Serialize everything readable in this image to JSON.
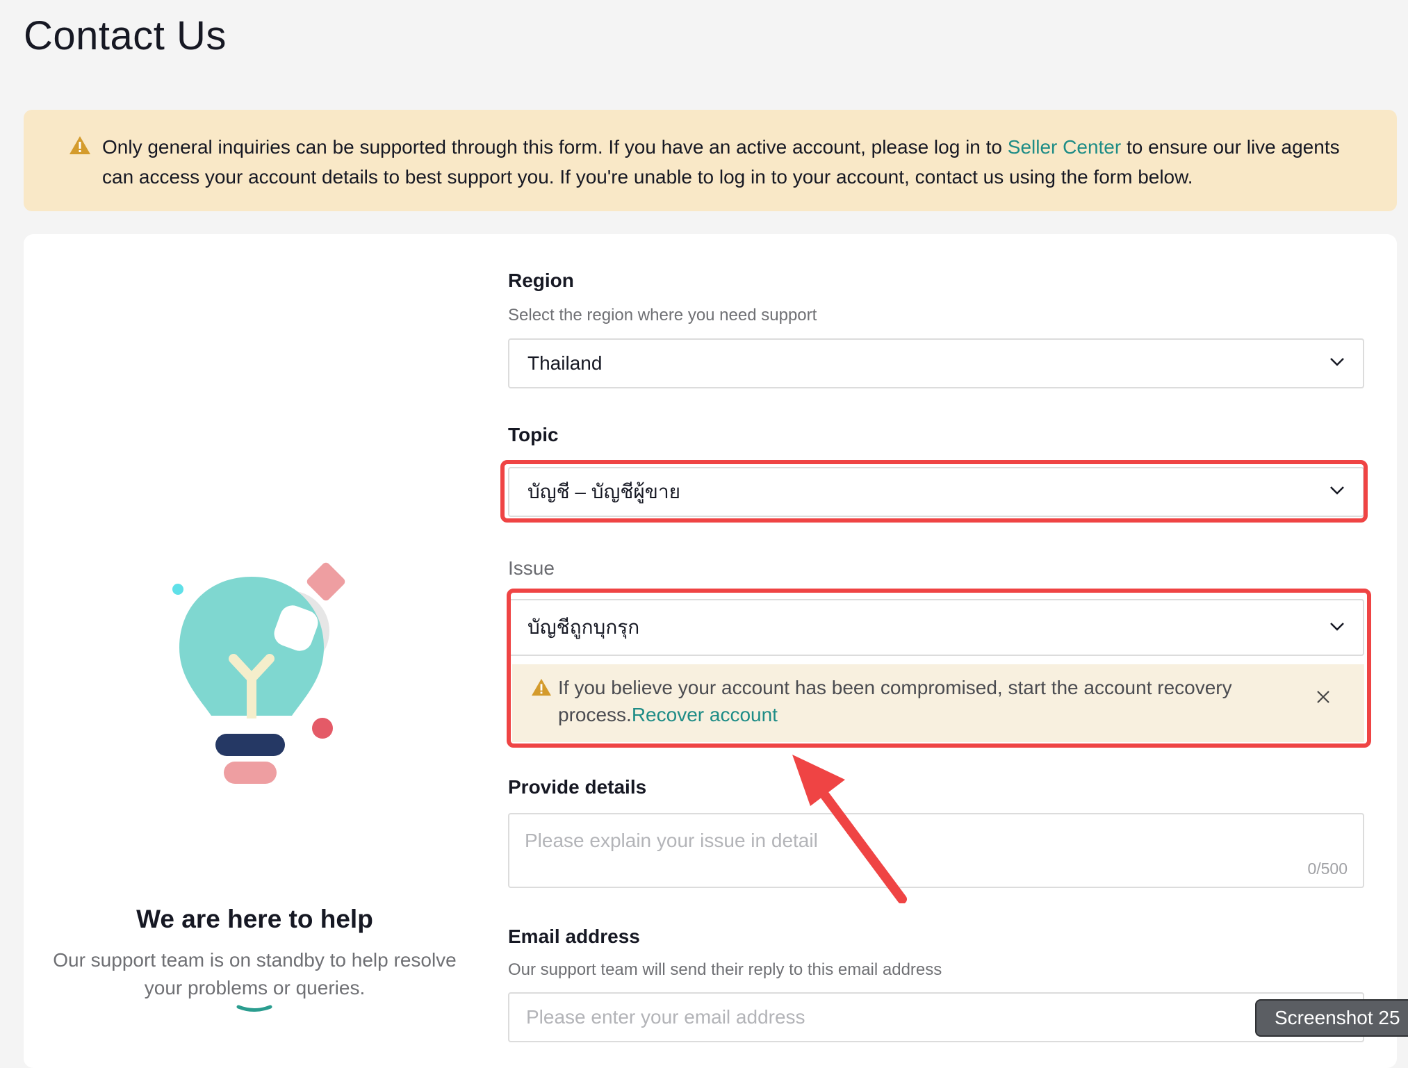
{
  "page": {
    "title": "Contact Us"
  },
  "notice": {
    "text_before": "Only general inquiries can be supported through this form. If you have an active account, please log in to ",
    "link": "Seller Center",
    "text_after": " to ensure our live agents can access your account details to best support you. If you're unable to log in to your account, contact us using the form below."
  },
  "help": {
    "title": "We are here to help",
    "description": "Our support team is on standby to help resolve your problems or queries."
  },
  "form": {
    "region": {
      "label": "Region",
      "help": "Select the region where you need support",
      "value": "Thailand"
    },
    "topic": {
      "label": "Topic",
      "value": "บัญชี – บัญชีผู้ขาย"
    },
    "issue": {
      "label": "Issue",
      "value": "บัญชีถูกบุกรุก",
      "alert_text": "If you believe your account has been compromised, start the account recovery process.",
      "alert_link": "Recover account"
    },
    "details": {
      "label": "Provide details",
      "placeholder": "Please explain your issue in detail",
      "counter": "0/500"
    },
    "email": {
      "label": "Email address",
      "help": "Our support team will send their reply to this email address",
      "placeholder": "Please enter your email address"
    }
  },
  "overlay": {
    "screenshot_label": "Screenshot 25"
  },
  "colors": {
    "link": "#1e8c86",
    "highlight": "#ef4444",
    "banner": "#f9e8c7",
    "alert_bg": "#f8f0df"
  }
}
